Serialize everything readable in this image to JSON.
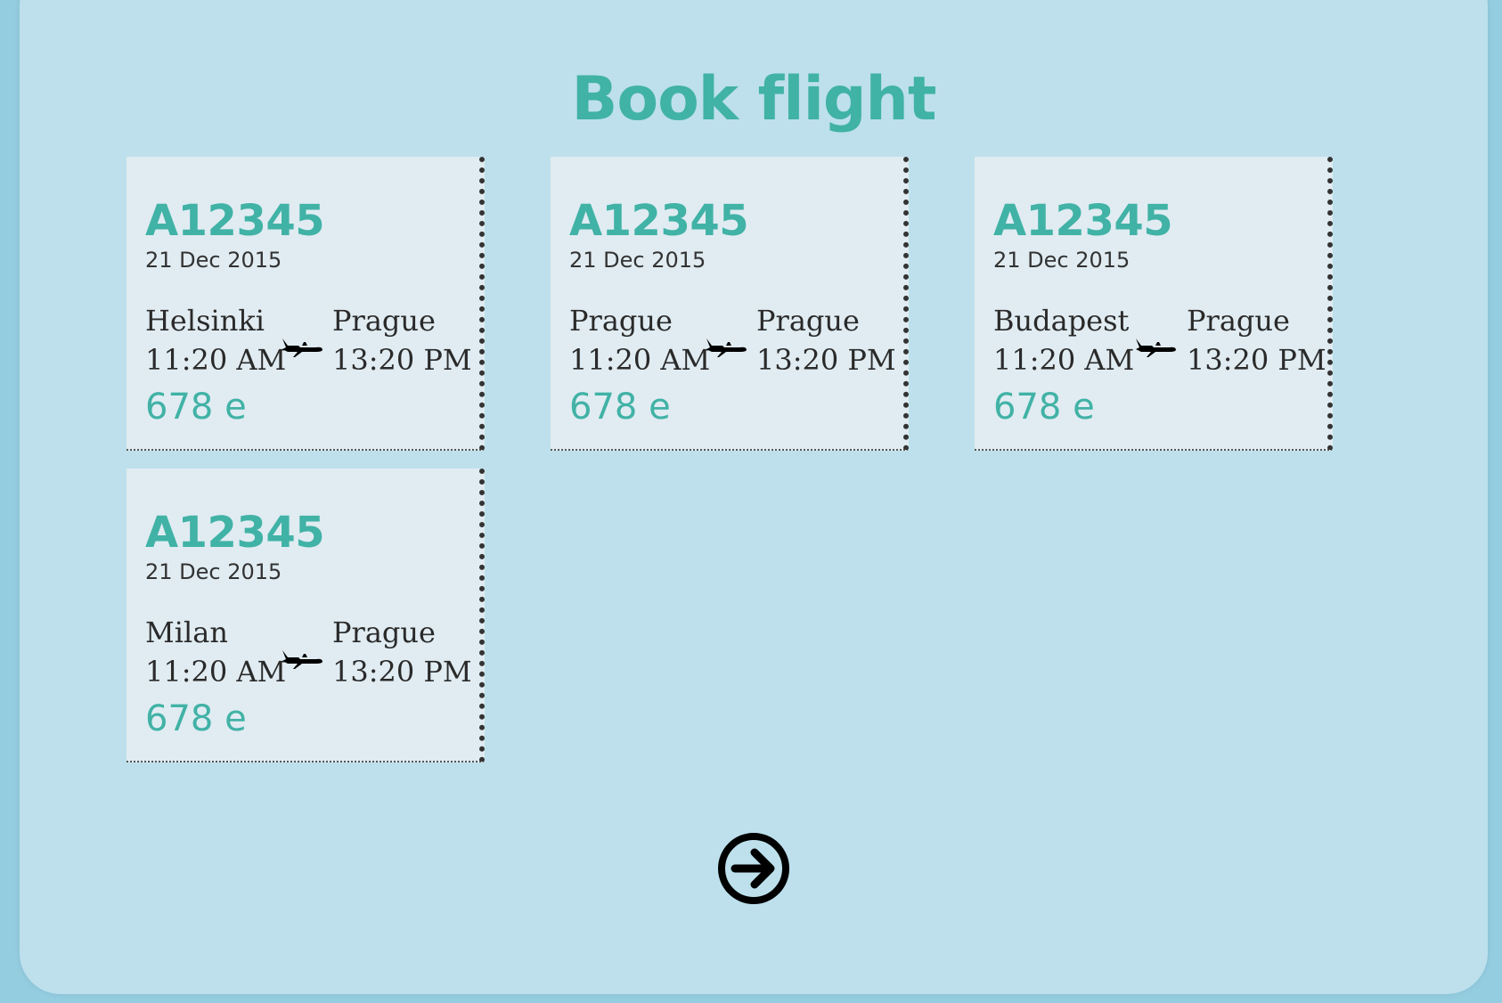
{
  "page": {
    "title": "Book flight"
  },
  "flights": [
    {
      "code": "A12345",
      "date": "21 Dec 2015",
      "origin": "Helsinki",
      "departure": "11:20 AM",
      "destination": "Prague",
      "arrival": "13:20 PM",
      "price": "678 e"
    },
    {
      "code": "A12345",
      "date": "21 Dec 2015",
      "origin": "Prague",
      "departure": "11:20 AM",
      "destination": "Prague",
      "arrival": "13:20 PM",
      "price": "678 e"
    },
    {
      "code": "A12345",
      "date": "21 Dec 2015",
      "origin": "Budapest",
      "departure": "11:20 AM",
      "destination": "Prague",
      "arrival": "13:20 PM",
      "price": "678 e"
    },
    {
      "code": "A12345",
      "date": "21 Dec 2015",
      "origin": "Milan",
      "departure": "11:20 AM",
      "destination": "Prague",
      "arrival": "13:20 PM",
      "price": "678 e"
    }
  ],
  "icons": {
    "route": "airplane-icon",
    "next": "arrow-right-circle-icon"
  },
  "colors": {
    "accent": "#41b2a6",
    "panel": "#bde0ec",
    "page_bg": "#95cde0",
    "card": "#e0ecf2",
    "text": "#2a2a2a"
  }
}
